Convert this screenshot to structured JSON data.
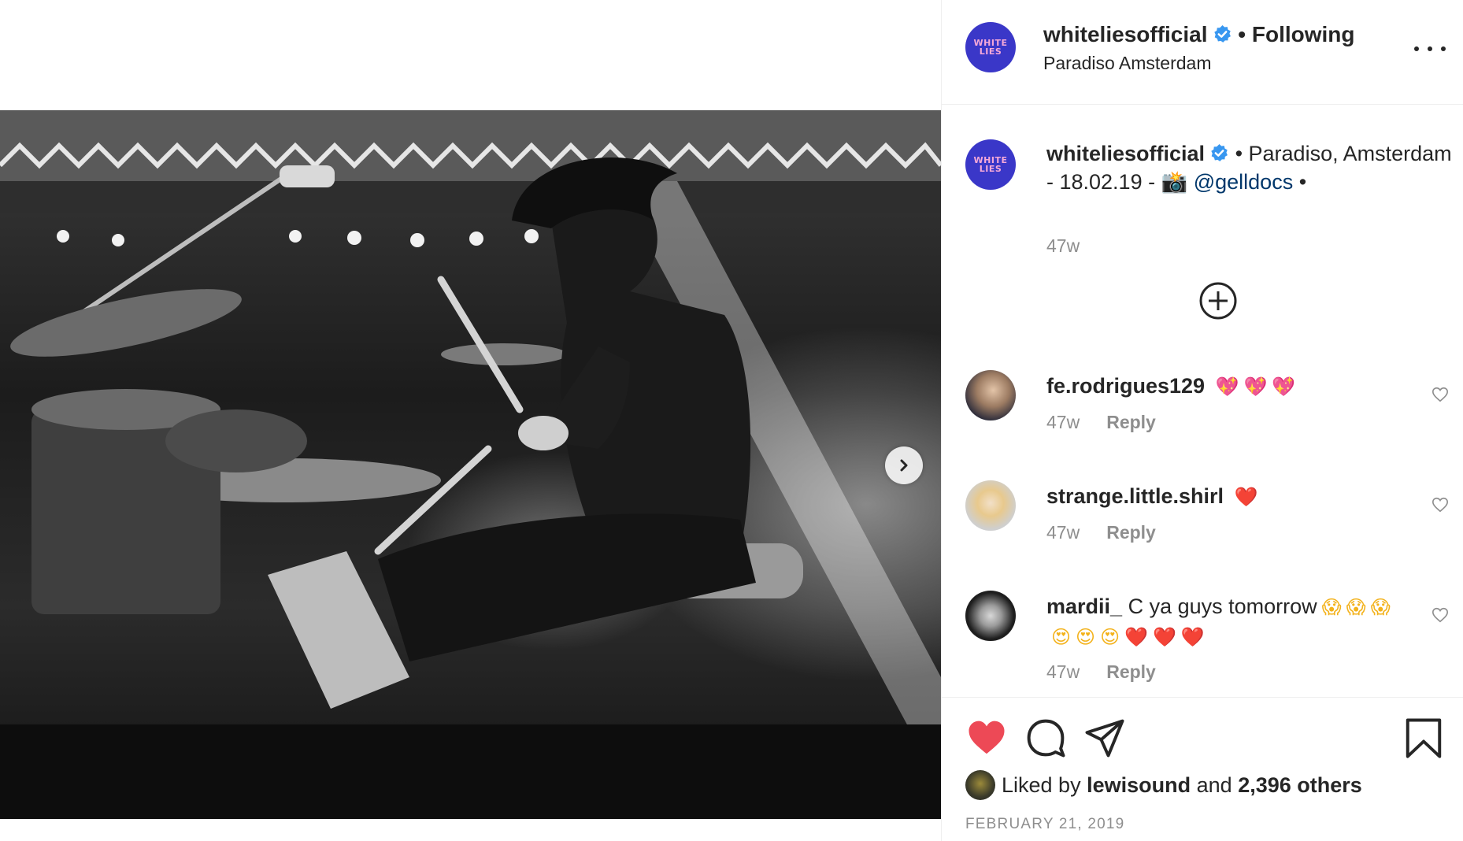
{
  "post": {
    "username": "whiteliesofficial",
    "follow_status": "Following",
    "location": "Paradiso Amsterdam",
    "brand_logo_top": "WHITE",
    "brand_logo_bottom": "LIES",
    "brand_color": "#3a37c8"
  },
  "caption": {
    "username": "whiteliesofficial",
    "text_before": " • Paradiso, Amsterdam - 18.02.19 - 📸 ",
    "mention": "@gelldocs",
    "text_after": " •",
    "time": "47w"
  },
  "comments": [
    {
      "username": "fe.rodrigues129",
      "text": "",
      "emojis": [
        "💖",
        "💖",
        "💖"
      ],
      "time": "47w",
      "reply_label": "Reply"
    },
    {
      "username": "strange.little.shirl",
      "text": "",
      "emojis": [
        "❤️"
      ],
      "time": "47w",
      "reply_label": "Reply"
    },
    {
      "username": "mardii_",
      "text": "C ya guys tomorrow",
      "emojis": [
        "😱",
        "😱",
        "😱",
        "😍",
        "😍",
        "😍",
        "❤️",
        "❤️",
        "❤️"
      ],
      "time": "47w",
      "reply_label": "Reply"
    }
  ],
  "likes": {
    "prefix": "Liked by",
    "user": "lewisound",
    "middle": "and",
    "count_text": "2,396 others"
  },
  "date": "FEBRUARY 21, 2019",
  "colors": {
    "like_red": "#ed4956",
    "link_blue": "#00376b",
    "verified_blue": "#3897f0",
    "muted": "#8e8e8e"
  },
  "icons": [
    "verified-icon",
    "more-options-icon",
    "load-more-icon",
    "heart-icon",
    "comment-icon",
    "share-icon",
    "bookmark-icon",
    "next-icon"
  ]
}
